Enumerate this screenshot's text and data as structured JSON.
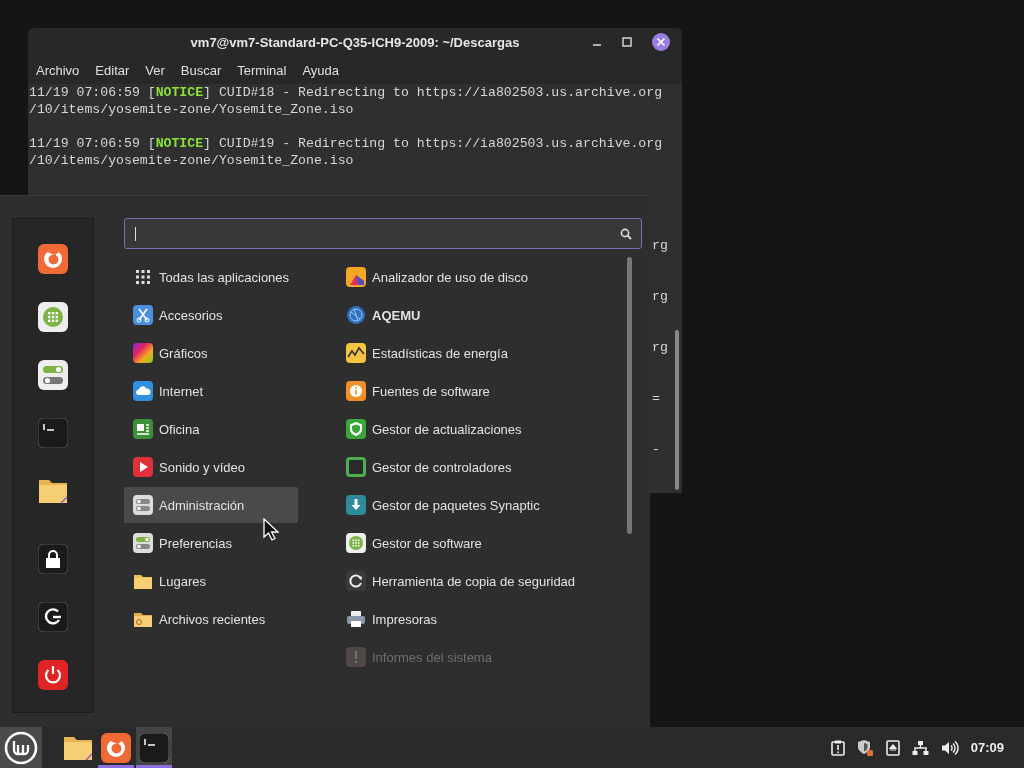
{
  "terminal": {
    "title": "vm7@vm7-Standard-PC-Q35-ICH9-2009: ~/Descargas",
    "menu": [
      "Archivo",
      "Editar",
      "Ver",
      "Buscar",
      "Terminal",
      "Ayuda"
    ],
    "lines": [
      {
        "kind": "log",
        "prefix": "11/19 07:06:59 [",
        "tag": "NOTICE",
        "suffix": "] CUID#18 - Redirecting to https://ia802503.us.archive.org"
      },
      {
        "kind": "text",
        "text": "/10/items/yosemite-zone/Yosemite_Zone.iso"
      },
      {
        "kind": "blank"
      },
      {
        "kind": "log",
        "prefix": "11/19 07:06:59 [",
        "tag": "NOTICE",
        "suffix": "] CUID#19 - Redirecting to https://ia802503.us.archive.org"
      },
      {
        "kind": "text",
        "text": "/10/items/yosemite-zone/Yosemite_Zone.iso"
      },
      {
        "kind": "blank"
      },
      {
        "kind": "blank"
      },
      {
        "kind": "blank"
      },
      {
        "kind": "blank"
      },
      {
        "kind": "fragment",
        "text": "rg"
      },
      {
        "kind": "blank"
      },
      {
        "kind": "blank"
      },
      {
        "kind": "fragment",
        "text": "rg"
      },
      {
        "kind": "blank"
      },
      {
        "kind": "blank"
      },
      {
        "kind": "fragment",
        "text": "rg"
      },
      {
        "kind": "blank"
      },
      {
        "kind": "blank"
      },
      {
        "kind": "fragment",
        "text": "="
      },
      {
        "kind": "blank"
      },
      {
        "kind": "blank"
      },
      {
        "kind": "fragment",
        "text": "-"
      }
    ]
  },
  "app_menu": {
    "categories": [
      {
        "label": "Todas las aplicaciones",
        "selected": false
      },
      {
        "label": "Accesorios",
        "selected": false
      },
      {
        "label": "Gráficos",
        "selected": false
      },
      {
        "label": "Internet",
        "selected": false
      },
      {
        "label": "Oficina",
        "selected": false
      },
      {
        "label": "Sonido y vídeo",
        "selected": false
      },
      {
        "label": "Administración",
        "selected": true
      },
      {
        "label": "Preferencias",
        "selected": false
      },
      {
        "label": "Lugares",
        "selected": false
      },
      {
        "label": "Archivos recientes",
        "selected": false
      }
    ],
    "applications": [
      {
        "label": "Analizador de uso de disco",
        "new": false,
        "disabled": false
      },
      {
        "label": "AQEMU",
        "new": true,
        "disabled": false
      },
      {
        "label": "Estadísticas de energía",
        "new": false,
        "disabled": false
      },
      {
        "label": "Fuentes de software",
        "new": false,
        "disabled": false
      },
      {
        "label": "Gestor de actualizaciones",
        "new": false,
        "disabled": false
      },
      {
        "label": "Gestor de controladores",
        "new": false,
        "disabled": false
      },
      {
        "label": "Gestor de paquetes Synaptic",
        "new": false,
        "disabled": false
      },
      {
        "label": "Gestor de software",
        "new": false,
        "disabled": false
      },
      {
        "label": "Herramienta de copia de seguridad",
        "new": false,
        "disabled": false
      },
      {
        "label": "Impresoras",
        "new": false,
        "disabled": false
      },
      {
        "label": "Informes del sistema",
        "new": false,
        "disabled": true
      }
    ]
  },
  "taskbar": {
    "apps": [
      {
        "running": false,
        "focused": false
      },
      {
        "running": true,
        "focused": false
      },
      {
        "running": true,
        "focused": true
      }
    ],
    "clock": "07:09"
  }
}
